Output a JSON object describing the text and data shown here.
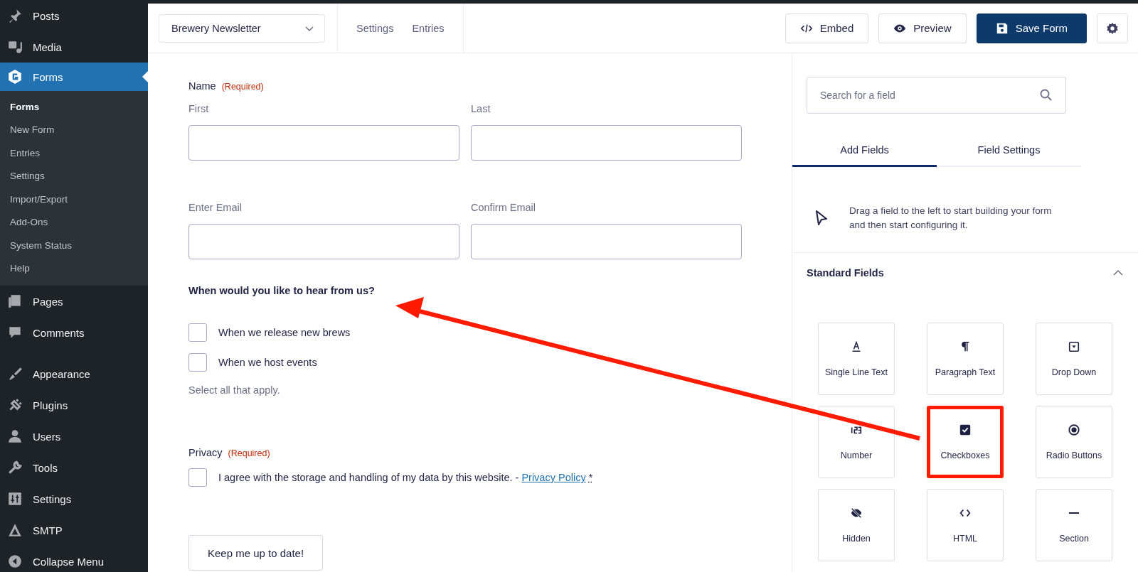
{
  "sidebar": {
    "menu_groups": [
      [
        {
          "label": "Posts",
          "selected": false
        },
        {
          "label": "Media",
          "selected": false
        },
        {
          "label": "Forms",
          "selected": true,
          "submenu": [
            {
              "label": "Forms",
              "selected": true
            },
            {
              "label": "New Form",
              "selected": false
            },
            {
              "label": "Entries",
              "selected": false
            },
            {
              "label": "Settings",
              "selected": false
            },
            {
              "label": "Import/Export",
              "selected": false
            },
            {
              "label": "Add-Ons",
              "selected": false
            },
            {
              "label": "System Status",
              "selected": false
            },
            {
              "label": "Help",
              "selected": false
            }
          ]
        },
        {
          "label": "Pages",
          "selected": false
        },
        {
          "label": "Comments",
          "selected": false
        }
      ],
      [
        {
          "label": "Appearance",
          "selected": false
        },
        {
          "label": "Plugins",
          "selected": false
        },
        {
          "label": "Users",
          "selected": false
        },
        {
          "label": "Tools",
          "selected": false
        },
        {
          "label": "Settings",
          "selected": false
        },
        {
          "label": "SMTP",
          "selected": false
        },
        {
          "label": "Collapse Menu",
          "selected": false
        }
      ]
    ]
  },
  "toolbar": {
    "form_selector": "Brewery Newsletter",
    "nav": [
      "Settings",
      "Entries"
    ],
    "buttons": [
      {
        "label": "Embed",
        "kind": "embed"
      },
      {
        "label": "Preview",
        "kind": "preview"
      },
      {
        "label": "Save Form",
        "kind": "save"
      },
      {
        "kind": "settings"
      }
    ]
  },
  "form": {
    "fields": [
      {
        "kind": "name",
        "label": "Name",
        "required": "(Required)",
        "inputs": [
          {
            "sublabel": "First"
          },
          {
            "sublabel": "Last"
          }
        ]
      },
      {
        "kind": "email",
        "inputs": [
          {
            "sublabel": "Enter Email"
          },
          {
            "sublabel": "Confirm Email"
          }
        ]
      },
      {
        "kind": "checkbox",
        "label": "When would you like to hear from us?",
        "choices": [
          {
            "label": "When we release new brews",
            "checked": false
          },
          {
            "label": "When we host events",
            "checked": false
          }
        ],
        "description": "Select all that apply."
      },
      {
        "kind": "consent",
        "label": "Privacy",
        "required": "(Required)",
        "checked": false,
        "text": "I agree with the storage and handling of my data by this website. -",
        "link": "Privacy Policy",
        "asterisk": "*"
      }
    ],
    "submit": "Keep me up to date!"
  },
  "panel": {
    "search": {
      "placeholder": "Search for a field"
    },
    "tabs": [
      {
        "label": "Add Fields",
        "selected": true
      },
      {
        "label": "Field Settings",
        "selected": false
      }
    ],
    "hint": "Drag a field to the left to start building your form and then start configuring it.",
    "section": {
      "title": "Standard Fields",
      "expanded": true,
      "fields": [
        {
          "label": "Single Line Text",
          "highlighted": false
        },
        {
          "label": "Paragraph Text",
          "highlighted": false
        },
        {
          "label": "Drop Down",
          "highlighted": false
        },
        {
          "label": "Number",
          "highlighted": false
        },
        {
          "label": "Checkboxes",
          "highlighted": true
        },
        {
          "label": "Radio Buttons",
          "highlighted": false
        },
        {
          "label": "Hidden",
          "highlighted": false
        },
        {
          "label": "HTML",
          "highlighted": false
        },
        {
          "label": "Section",
          "highlighted": false
        }
      ]
    }
  }
}
